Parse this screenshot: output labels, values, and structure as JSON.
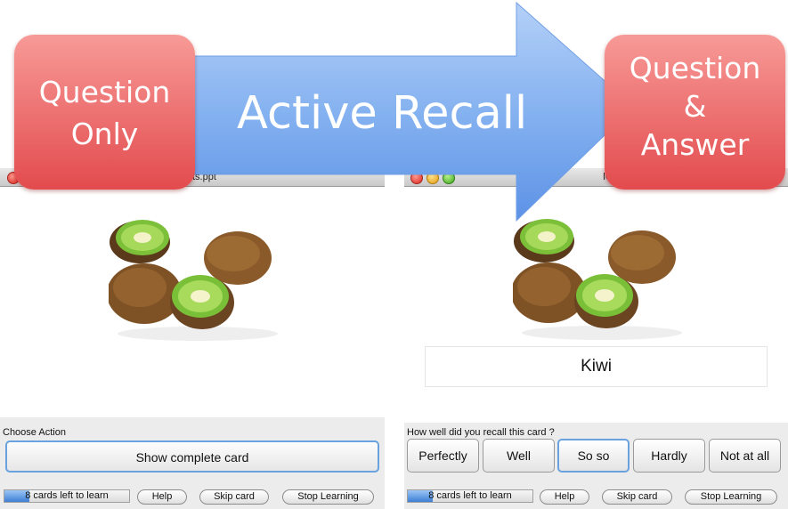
{
  "overlay": {
    "left_callout_lines": [
      "Question",
      "Only"
    ],
    "right_callout_lines": [
      "Question",
      "&",
      "Answer"
    ],
    "arrow_label": "Active Recall",
    "colors": {
      "arrow": "#7fb0f0",
      "callout": "#e84e50"
    }
  },
  "left_window": {
    "title": "s: fruits.ppt",
    "card_image": "kiwi-fruit-image",
    "section_label": "Choose Action",
    "show_button": "Show complete card",
    "progress": {
      "text": "8 cards left to learn",
      "fraction": 0.2
    },
    "buttons": {
      "help": "Help",
      "skip": "Skip card",
      "stop": "Stop Learning"
    }
  },
  "right_window": {
    "title": "lCards: fr",
    "card_image": "kiwi-fruit-image",
    "answer": "Kiwi",
    "section_label": "How well did you recall this card ?",
    "ratings": [
      "Perfectly",
      "Well",
      "So so",
      "Hardly",
      "Not at all"
    ],
    "focused_rating": "So so",
    "progress": {
      "text": "8 cards left to learn",
      "fraction": 0.2
    },
    "buttons": {
      "help": "Help",
      "skip": "Skip card",
      "stop": "Stop Learning"
    }
  }
}
